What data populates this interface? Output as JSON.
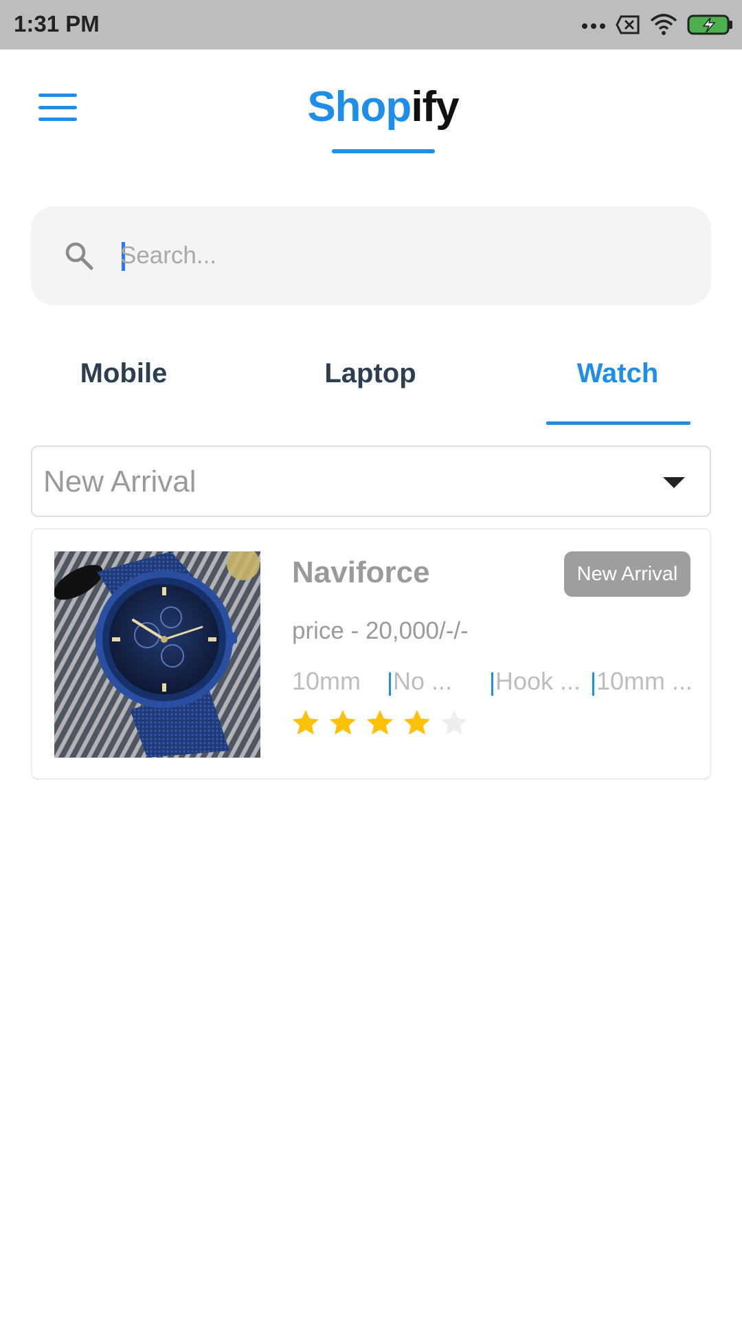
{
  "status_bar": {
    "time": "1:31 PM",
    "icons": [
      "more-dots-icon",
      "close-box-icon",
      "wifi-icon",
      "battery-charging-icon"
    ]
  },
  "header": {
    "logo_part1": "Shop",
    "logo_part2": "ify",
    "menu_icon": "hamburger-menu-icon",
    "brand_color": "#1f8ee8"
  },
  "search": {
    "placeholder": "Search...",
    "value": "",
    "icon": "search-icon"
  },
  "tabs": [
    {
      "label": "Mobile",
      "active": false
    },
    {
      "label": "Laptop",
      "active": false
    },
    {
      "label": "Watch",
      "active": true
    }
  ],
  "filter": {
    "selected": "New Arrival",
    "icon": "caret-down-icon"
  },
  "products": [
    {
      "name": "Naviforce",
      "badge": "New Arrival",
      "price": "price - 20,000/-/-",
      "specs": [
        "10mm",
        "No ...",
        "Hook ...",
        "10mm ..."
      ],
      "rating": 4,
      "rating_max": 5,
      "image": "blue-wristwatch-image"
    }
  ],
  "colors": {
    "accent": "#1f8ee8",
    "star_filled": "#ffc107",
    "star_empty": "#eeeeee",
    "badge_bg": "#9e9e9e"
  }
}
